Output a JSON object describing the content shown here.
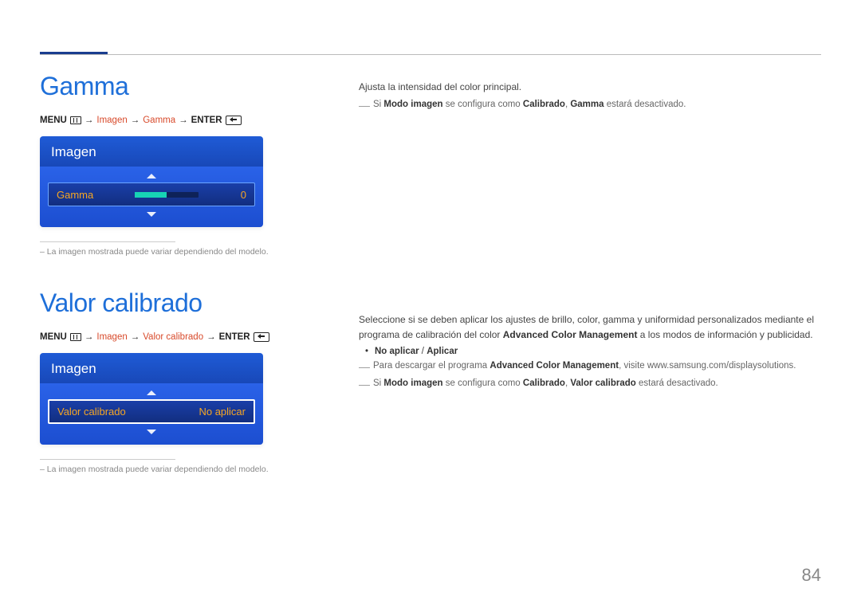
{
  "page_number": "84",
  "section1": {
    "title": "Gamma",
    "breadcrumb": {
      "menu": "MENU",
      "step_image": "Imagen",
      "step_gamma": "Gamma",
      "enter": "ENTER"
    },
    "panel": {
      "header": "Imagen",
      "row_label": "Gamma",
      "row_value": "0"
    },
    "caption": "–  La imagen mostrada puede variar dependiendo del modelo.",
    "desc": "Ajusta la intensidad del color principal.",
    "note": {
      "pre": "Si ",
      "modo": "Modo imagen",
      "mid": " se configura como ",
      "calibrado": "Calibrado",
      "sep": ", ",
      "gamma": "Gamma",
      "post": " estará desactivado."
    }
  },
  "section2": {
    "title": "Valor calibrado",
    "breadcrumb": {
      "menu": "MENU",
      "step_image": "Imagen",
      "step_valor": "Valor calibrado",
      "enter": "ENTER"
    },
    "panel": {
      "header": "Imagen",
      "row_label": "Valor calibrado",
      "row_value": "No aplicar"
    },
    "caption": "–  La imagen mostrada puede variar dependiendo del modelo.",
    "desc_line1": "Seleccione si se deben aplicar los ajustes de brillo, color, gamma y uniformidad personalizados mediante el programa de calibración del color ",
    "desc_acm": "Advanced Color Management",
    "desc_line1_end": " a los modos de información y publicidad.",
    "options": {
      "a": "No aplicar",
      "sep": " / ",
      "b": "Aplicar"
    },
    "note1_pre": "Para descargar el programa ",
    "note1_acm": "Advanced Color Management",
    "note1_post": ", visite www.samsung.com/displaysolutions.",
    "note2": {
      "pre": "Si ",
      "modo": "Modo imagen",
      "mid": " se configura como ",
      "calibrado": "Calibrado",
      "sep": ", ",
      "valor": "Valor calibrado",
      "post": " estará desactivado."
    }
  }
}
